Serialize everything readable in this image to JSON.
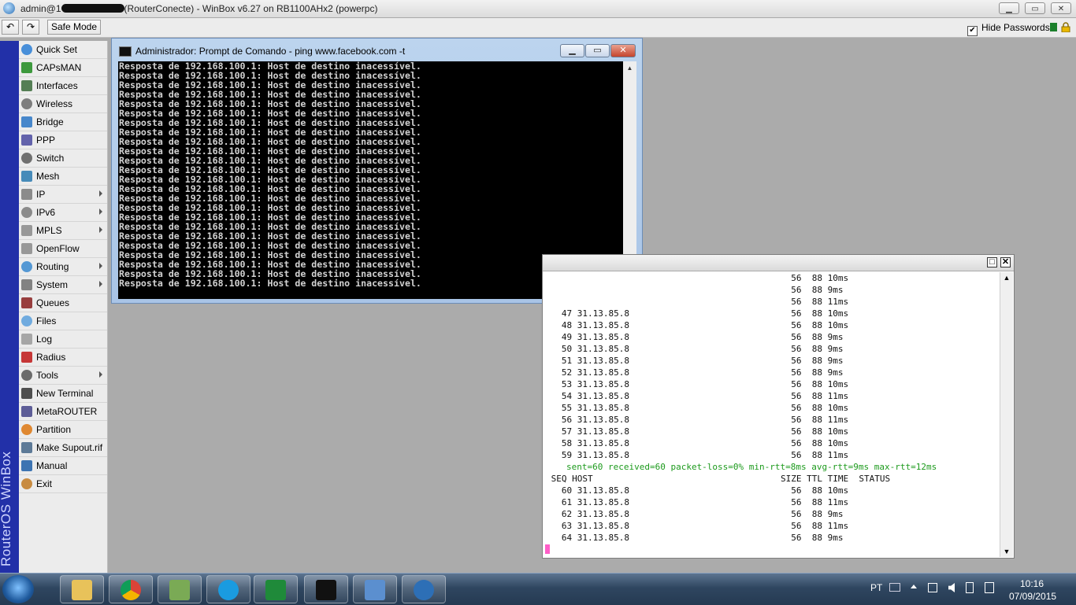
{
  "window": {
    "title_prefix": "admin@1",
    "title_suffix": "(RouterConecte) - WinBox v6.27 on RB1100AHx2 (powerpc)",
    "min": "▁",
    "max": "▭",
    "close": "✕"
  },
  "toolbar": {
    "undo": "↶",
    "redo": "↷",
    "safe_mode": "Safe Mode",
    "hide_passwords_check": "✔",
    "hide_passwords": "Hide Passwords"
  },
  "brand": "RouterOS WinBox",
  "menu": [
    {
      "label": "Quick Set",
      "icon": "quick-set-icon",
      "arrow": false
    },
    {
      "label": "CAPsMAN",
      "icon": "capsman-icon",
      "arrow": false
    },
    {
      "label": "Interfaces",
      "icon": "interfaces-icon",
      "arrow": false
    },
    {
      "label": "Wireless",
      "icon": "wireless-icon",
      "arrow": false
    },
    {
      "label": "Bridge",
      "icon": "bridge-icon",
      "arrow": false
    },
    {
      "label": "PPP",
      "icon": "ppp-icon",
      "arrow": false
    },
    {
      "label": "Switch",
      "icon": "switch-icon",
      "arrow": false
    },
    {
      "label": "Mesh",
      "icon": "mesh-icon",
      "arrow": false
    },
    {
      "label": "IP",
      "icon": "ip-icon",
      "arrow": true
    },
    {
      "label": "IPv6",
      "icon": "ipv6-icon",
      "arrow": true
    },
    {
      "label": "MPLS",
      "icon": "mpls-icon",
      "arrow": true
    },
    {
      "label": "OpenFlow",
      "icon": "openflow-icon",
      "arrow": false
    },
    {
      "label": "Routing",
      "icon": "routing-icon",
      "arrow": true
    },
    {
      "label": "System",
      "icon": "system-icon",
      "arrow": true
    },
    {
      "label": "Queues",
      "icon": "queues-icon",
      "arrow": false
    },
    {
      "label": "Files",
      "icon": "files-icon",
      "arrow": false
    },
    {
      "label": "Log",
      "icon": "log-icon",
      "arrow": false
    },
    {
      "label": "Radius",
      "icon": "radius-icon",
      "arrow": false
    },
    {
      "label": "Tools",
      "icon": "tools-icon",
      "arrow": true
    },
    {
      "label": "New Terminal",
      "icon": "terminal-icon",
      "arrow": false
    },
    {
      "label": "MetaROUTER",
      "icon": "metarouter-icon",
      "arrow": false
    },
    {
      "label": "Partition",
      "icon": "partition-icon",
      "arrow": false
    },
    {
      "label": "Make Supout.rif",
      "icon": "supout-icon",
      "arrow": false
    },
    {
      "label": "Manual",
      "icon": "manual-icon",
      "arrow": false
    },
    {
      "label": "Exit",
      "icon": "exit-icon",
      "arrow": false
    }
  ],
  "cmd": {
    "title": "Administrador: Prompt de Comando - ping  www.facebook.com -t",
    "min": "▁",
    "max": "▭",
    "close": "✕",
    "line": "Resposta de 192.168.100.1: Host de destino inacessível.",
    "line_count": 24,
    "scroll_up": "▲",
    "scroll_down": "▼"
  },
  "ping": {
    "max": "□",
    "close": "✕",
    "scroll_up": "▲",
    "scroll_down": "▼",
    "rows_a": [
      {
        "seq": "",
        "host": "",
        "size": "56",
        "ttl": "88",
        "time": "10ms"
      },
      {
        "seq": "",
        "host": "",
        "size": "56",
        "ttl": "88",
        "time": "9ms"
      },
      {
        "seq": "",
        "host": "",
        "size": "56",
        "ttl": "88",
        "time": "11ms"
      },
      {
        "seq": "47",
        "host": "31.13.85.8",
        "size": "56",
        "ttl": "88",
        "time": "10ms"
      },
      {
        "seq": "48",
        "host": "31.13.85.8",
        "size": "56",
        "ttl": "88",
        "time": "10ms"
      },
      {
        "seq": "49",
        "host": "31.13.85.8",
        "size": "56",
        "ttl": "88",
        "time": "9ms"
      },
      {
        "seq": "50",
        "host": "31.13.85.8",
        "size": "56",
        "ttl": "88",
        "time": "9ms"
      },
      {
        "seq": "51",
        "host": "31.13.85.8",
        "size": "56",
        "ttl": "88",
        "time": "9ms"
      },
      {
        "seq": "52",
        "host": "31.13.85.8",
        "size": "56",
        "ttl": "88",
        "time": "9ms"
      },
      {
        "seq": "53",
        "host": "31.13.85.8",
        "size": "56",
        "ttl": "88",
        "time": "10ms"
      },
      {
        "seq": "54",
        "host": "31.13.85.8",
        "size": "56",
        "ttl": "88",
        "time": "11ms"
      },
      {
        "seq": "55",
        "host": "31.13.85.8",
        "size": "56",
        "ttl": "88",
        "time": "10ms"
      },
      {
        "seq": "56",
        "host": "31.13.85.8",
        "size": "56",
        "ttl": "88",
        "time": "11ms"
      },
      {
        "seq": "57",
        "host": "31.13.85.8",
        "size": "56",
        "ttl": "88",
        "time": "10ms"
      },
      {
        "seq": "58",
        "host": "31.13.85.8",
        "size": "56",
        "ttl": "88",
        "time": "10ms"
      },
      {
        "seq": "59",
        "host": "31.13.85.8",
        "size": "56",
        "ttl": "88",
        "time": "11ms"
      }
    ],
    "summary": "sent=60 received=60 packet-loss=0% min-rtt=8ms avg-rtt=9ms max-rtt=12ms",
    "header": {
      "seq": "SEQ",
      "host": "HOST",
      "size": "SIZE",
      "ttl": "TTL",
      "time": "TIME",
      "status": "STATUS"
    },
    "rows_b": [
      {
        "seq": "60",
        "host": "31.13.85.8",
        "size": "56",
        "ttl": "88",
        "time": "10ms"
      },
      {
        "seq": "61",
        "host": "31.13.85.8",
        "size": "56",
        "ttl": "88",
        "time": "11ms"
      },
      {
        "seq": "62",
        "host": "31.13.85.8",
        "size": "56",
        "ttl": "88",
        "time": "9ms"
      },
      {
        "seq": "63",
        "host": "31.13.85.8",
        "size": "56",
        "ttl": "88",
        "time": "11ms"
      },
      {
        "seq": "64",
        "host": "31.13.85.8",
        "size": "56",
        "ttl": "88",
        "time": "9ms"
      }
    ]
  },
  "taskbar": {
    "apps": [
      "explorer-icon",
      "chrome-icon",
      "paint-icon",
      "skype-icon",
      "excel-icon",
      "cmd-icon",
      "control-panel-icon",
      "winbox-icon"
    ],
    "lang": "PT",
    "time": "10:16",
    "date": "07/09/2015"
  }
}
